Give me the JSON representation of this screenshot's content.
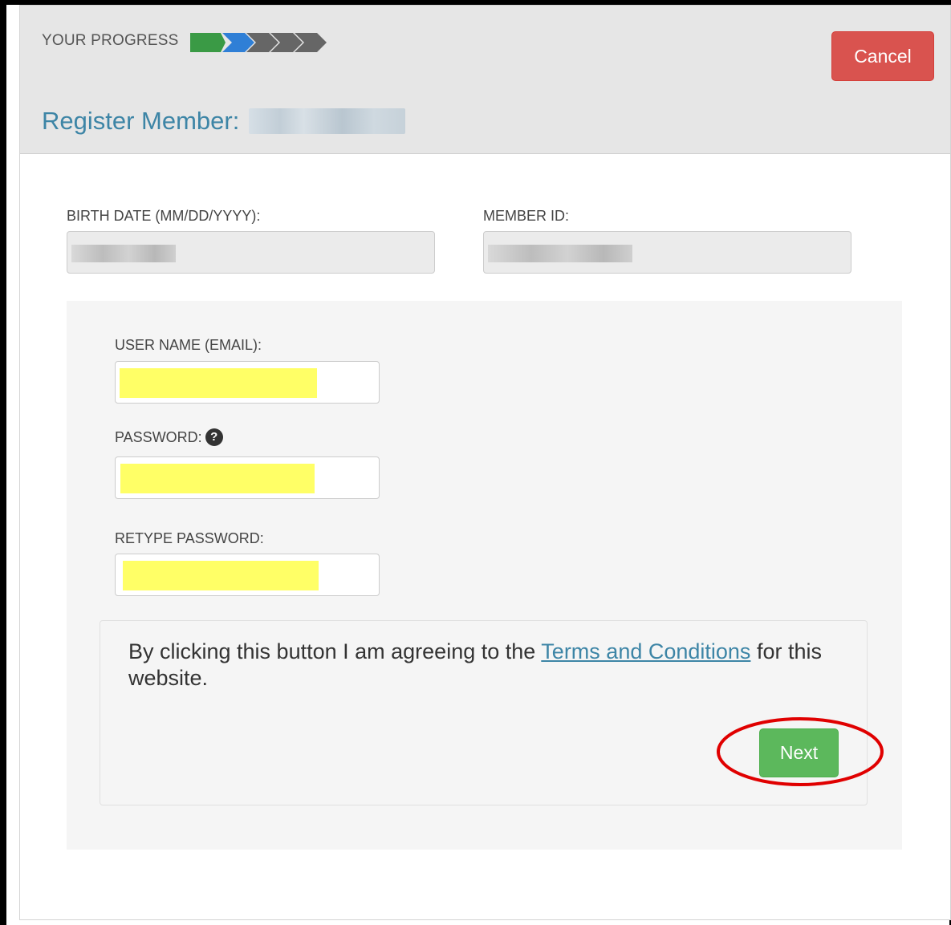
{
  "progress": {
    "label": "YOUR PROGRESS",
    "steps": [
      {
        "state": "complete",
        "color": "#3a9a45"
      },
      {
        "state": "current",
        "color": "#2f7fd6"
      },
      {
        "state": "pending",
        "color": "#666666"
      },
      {
        "state": "pending",
        "color": "#666666"
      },
      {
        "state": "pending",
        "color": "#666666"
      }
    ]
  },
  "header": {
    "cancel_label": "Cancel",
    "title": "Register Member:"
  },
  "fields": {
    "birth_date_label": "BIRTH DATE (MM/DD/YYYY):",
    "member_id_label": "MEMBER ID:",
    "username_label": "USER NAME (EMAIL):",
    "password_label": "PASSWORD:",
    "password_help_icon": "?",
    "retype_password_label": "RETYPE PASSWORD:"
  },
  "agreement": {
    "text_before": "By clicking this button I am agreeing to the ",
    "link_text": "Terms and Conditions",
    "text_after": " for this website.",
    "next_label": "Next"
  },
  "colors": {
    "title": "#3d85a6",
    "cancel": "#d9534f",
    "next": "#5cb85c",
    "autofill_highlight": "#ffff66",
    "annotation_circle": "#e00000"
  }
}
